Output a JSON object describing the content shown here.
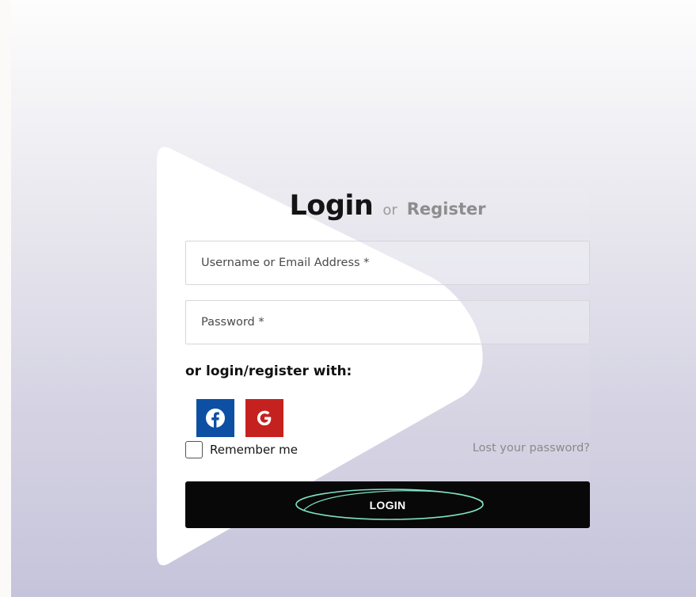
{
  "heading": {
    "login": "Login",
    "or": "or",
    "register": "Register"
  },
  "fields": {
    "username_placeholder": "Username or Email Address *",
    "username_value": "",
    "password_placeholder": "Password *",
    "password_value": ""
  },
  "social": {
    "label_or": "or",
    "label_rest": "login/register with:",
    "providers": [
      {
        "name": "facebook",
        "icon": "facebook-icon",
        "color": "#0d4fa3"
      },
      {
        "name": "google",
        "icon": "google-icon",
        "color": "#c5221f"
      }
    ]
  },
  "remember": {
    "label": "Remember me",
    "checked": false
  },
  "lost_password": "Lost your password?",
  "submit": {
    "label": "LOGIN",
    "accent": "#7fe3c0"
  },
  "colors": {
    "button_bg": "#080808",
    "title": "#141414",
    "muted": "#8d8d8d"
  }
}
